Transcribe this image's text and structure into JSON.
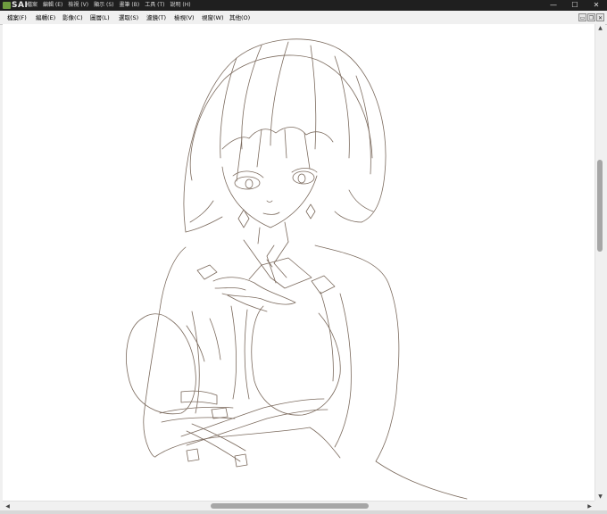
{
  "app": {
    "name": "SAI"
  },
  "title_menu": [
    "檔案",
    "編輯 (E)",
    "檢視 (V)",
    "顯示 (S)",
    "畫筆 (B)",
    "工具 (T)",
    "說明 (H)"
  ],
  "window_controls": {
    "minimize": "—",
    "maximize": "☐",
    "close": "✕"
  },
  "menu": [
    "檔案(F)",
    "編輯(E)",
    "影像(C)",
    "圖層(L)",
    "選取(S)",
    "濾鏡(T)",
    "檢視(V)",
    "視窗(W)",
    "其他(O)"
  ],
  "mdi_controls": [
    "▭",
    "❐",
    "✕"
  ],
  "scroll": {
    "up": "▲",
    "down": "▼",
    "left": "◀",
    "right": "▶"
  },
  "colors": {
    "titlebar": "#1f1f1f",
    "canvas": "#ffffff",
    "lineart": "#7b6a5d"
  },
  "icons": {
    "app": "sai-app-icon",
    "canvas": "lineart-drawing"
  }
}
